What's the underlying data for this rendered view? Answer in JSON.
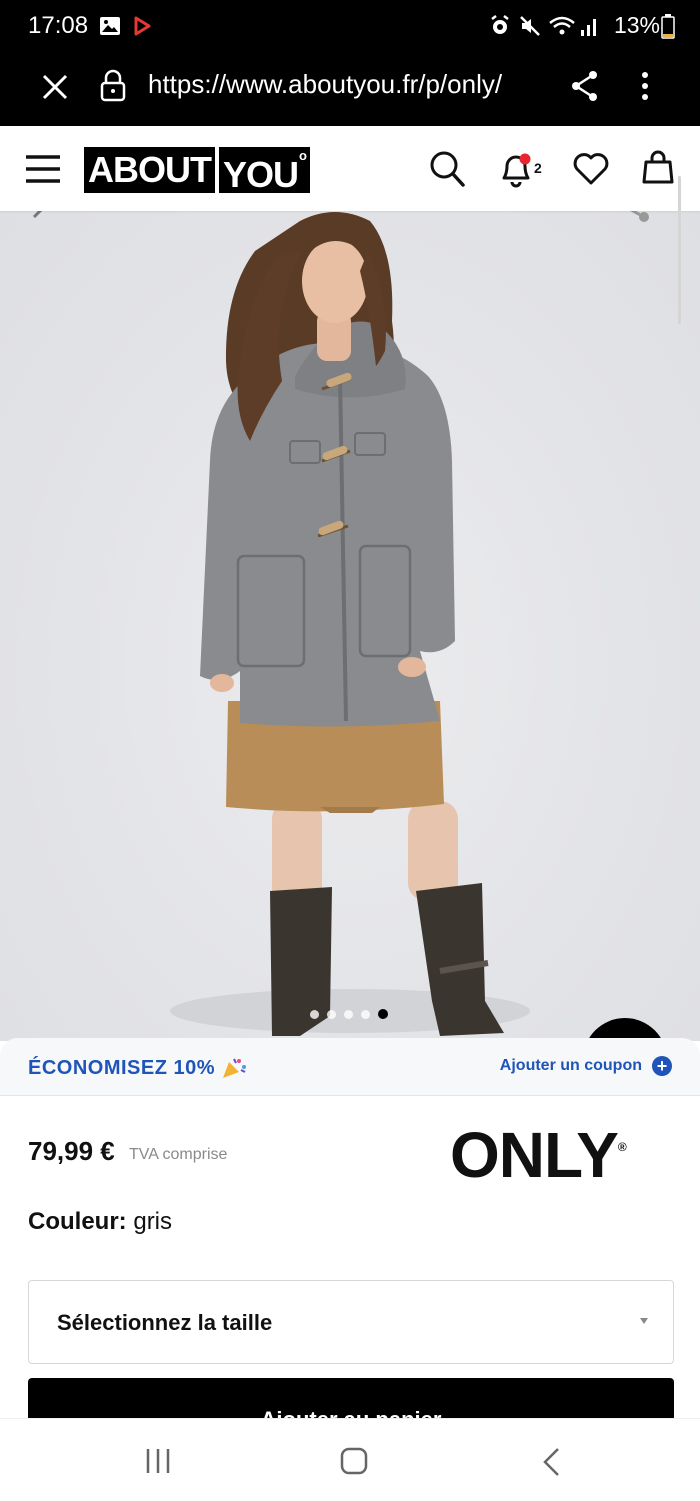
{
  "status_bar": {
    "time": "17:08",
    "battery": "13%"
  },
  "browser": {
    "url": "https://www.aboutyou.fr/p/only/"
  },
  "header": {
    "logo_part1": "ABOUT",
    "logo_part2": "YOU",
    "notification_count": "2"
  },
  "gallery": {
    "image_count": 5,
    "active_index": 4
  },
  "coupon": {
    "headline": "ÉCONOMISEZ 10%",
    "add_label": "Ajouter un coupon",
    "accent_color": "#1f55b8"
  },
  "product": {
    "price": "79,99 €",
    "tax_note": "TVA comprise",
    "brand": "ONLY",
    "color_label": "Couleur:",
    "color_value": "gris",
    "size_placeholder": "Sélectionnez la taille",
    "add_to_cart": "Ajouter au panier"
  }
}
